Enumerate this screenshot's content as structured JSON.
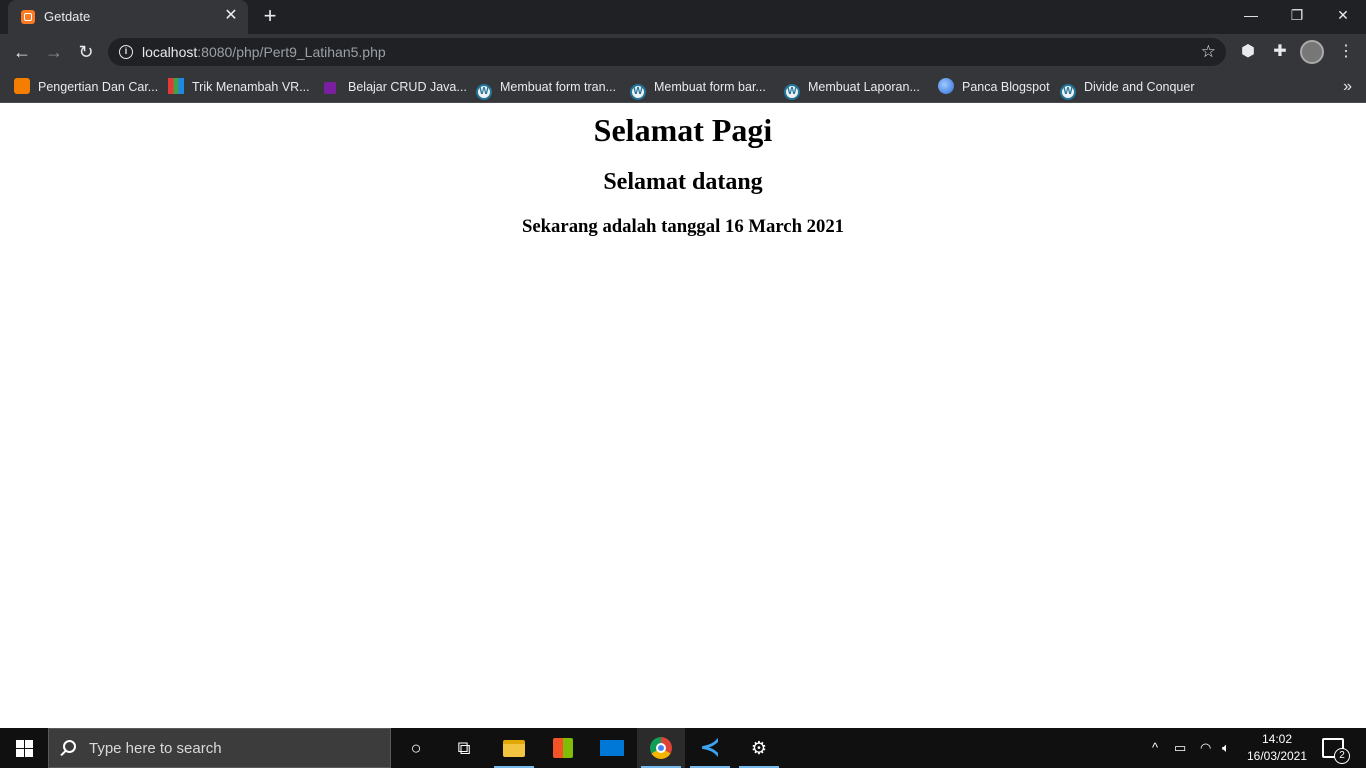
{
  "browser": {
    "tab": {
      "title": "Getdate",
      "close_icon": "close-icon",
      "favicon": "xampp-icon"
    },
    "new_tab_label": "+",
    "window_controls": {
      "minimize": "—",
      "restore": "❐",
      "close": "✕"
    },
    "nav": {
      "back": "←",
      "forward": "→",
      "reload": "↻"
    },
    "address": {
      "host": "localhost",
      "path": ":8080/php/Pert9_Latihan5.php"
    },
    "bookmarks": [
      {
        "label": "Pengertian Dan Car...",
        "icon": "blogger-icon"
      },
      {
        "label": "Trik Menambah VR...",
        "icon": "grid-icon"
      },
      {
        "label": "Belajar CRUD Java...",
        "icon": "site-icon"
      },
      {
        "label": "Membuat form tran...",
        "icon": "wordpress-icon"
      },
      {
        "label": "Membuat form bar...",
        "icon": "wordpress-icon"
      },
      {
        "label": "Membuat Laporan...",
        "icon": "wordpress-icon"
      },
      {
        "label": "Panca Blogspot",
        "icon": "globe-icon"
      },
      {
        "label": "Divide and Conquer",
        "icon": "wordpress-icon"
      }
    ],
    "bookmarks_more": "»"
  },
  "page": {
    "heading1": "Selamat Pagi",
    "heading2": "Selamat datang",
    "heading3": "Sekarang adalah tanggal 16 March 2021"
  },
  "taskbar": {
    "search_placeholder": "Type here to search",
    "clock": {
      "time": "14:02",
      "date": "16/03/2021"
    },
    "notification_count": "2",
    "tray": {
      "chevron": "^"
    }
  }
}
